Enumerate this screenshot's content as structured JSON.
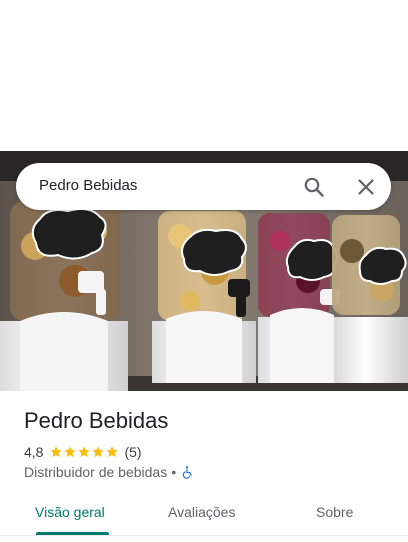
{
  "search": {
    "query": "Pedro Bebidas",
    "search_icon": "search-icon",
    "close_icon": "close-icon"
  },
  "place": {
    "name": "Pedro Bebidas",
    "rating": "4,8",
    "stars": 5,
    "review_count": "(5)",
    "category": "Distribuidor de bebidas",
    "separator": "•",
    "accessibility_icon": "wheelchair-accessible-icon"
  },
  "tabs": [
    {
      "label": "Visão geral",
      "active": true
    },
    {
      "label": "Avaliações",
      "active": false
    },
    {
      "label": "Sobre",
      "active": false
    }
  ],
  "colors": {
    "accent": "#00796b",
    "star": "#fbbc04",
    "accessible_icon": "#1a73e8",
    "title_text": "#202124",
    "secondary_text": "#5f6368"
  }
}
